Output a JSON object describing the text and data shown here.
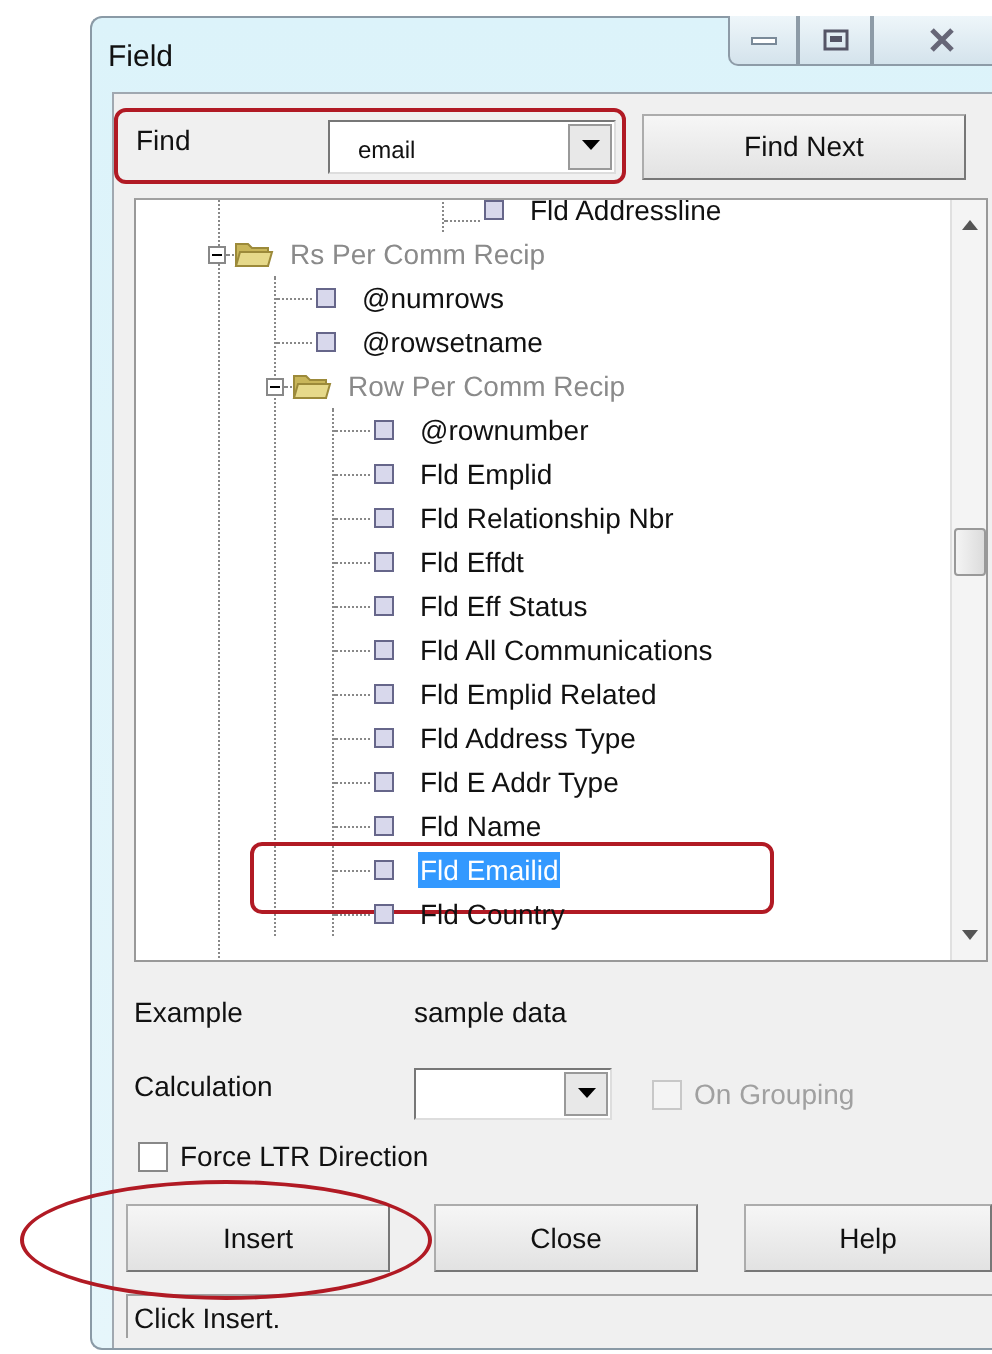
{
  "window": {
    "title": "Field"
  },
  "find": {
    "label": "Find",
    "value": "email",
    "highlighted": true
  },
  "find_next_button": "Find Next",
  "tree": [
    {
      "kind": "continuation",
      "children": [
        {
          "kind": "field",
          "label": "Fld Addressline",
          "selected": false,
          "highlighted": false
        }
      ]
    },
    {
      "kind": "folder",
      "label": "Rs Per Comm Recip",
      "expanded": true,
      "children": [
        {
          "kind": "field",
          "label": "@numrows",
          "selected": false,
          "highlighted": false
        },
        {
          "kind": "field",
          "label": "@rowsetname",
          "selected": false,
          "highlighted": false
        },
        {
          "kind": "folder",
          "label": "Row Per Comm Recip",
          "expanded": true,
          "children": [
            {
              "kind": "field",
              "label": "@rownumber",
              "selected": false,
              "highlighted": false
            },
            {
              "kind": "field",
              "label": "Fld Emplid",
              "selected": false,
              "highlighted": false
            },
            {
              "kind": "field",
              "label": "Fld Relationship Nbr",
              "selected": false,
              "highlighted": false
            },
            {
              "kind": "field",
              "label": "Fld Effdt",
              "selected": false,
              "highlighted": false
            },
            {
              "kind": "field",
              "label": "Fld Eff Status",
              "selected": false,
              "highlighted": false
            },
            {
              "kind": "field",
              "label": "Fld All Communications",
              "selected": false,
              "highlighted": false
            },
            {
              "kind": "field",
              "label": "Fld Emplid Related",
              "selected": false,
              "highlighted": false
            },
            {
              "kind": "field",
              "label": "Fld Address Type",
              "selected": false,
              "highlighted": false
            },
            {
              "kind": "field",
              "label": "Fld E Addr Type",
              "selected": false,
              "highlighted": false
            },
            {
              "kind": "field",
              "label": "Fld Name",
              "selected": false,
              "highlighted": false
            },
            {
              "kind": "field",
              "label": "Fld Emailid",
              "selected": true,
              "highlighted": true
            },
            {
              "kind": "field",
              "label": "Fld Country",
              "selected": false,
              "highlighted": false
            }
          ]
        }
      ]
    }
  ],
  "example": {
    "label": "Example",
    "value": "sample data"
  },
  "calculation": {
    "label": "Calculation",
    "on_grouping": {
      "label": "On Grouping",
      "checked": false,
      "disabled": true
    }
  },
  "force_ltr": {
    "label": "Force LTR Direction",
    "checked": false
  },
  "buttons": [
    {
      "label": "Insert",
      "highlighted": true
    },
    {
      "label": "Close"
    },
    {
      "label": "Help"
    }
  ],
  "status_bar": "Click Insert."
}
